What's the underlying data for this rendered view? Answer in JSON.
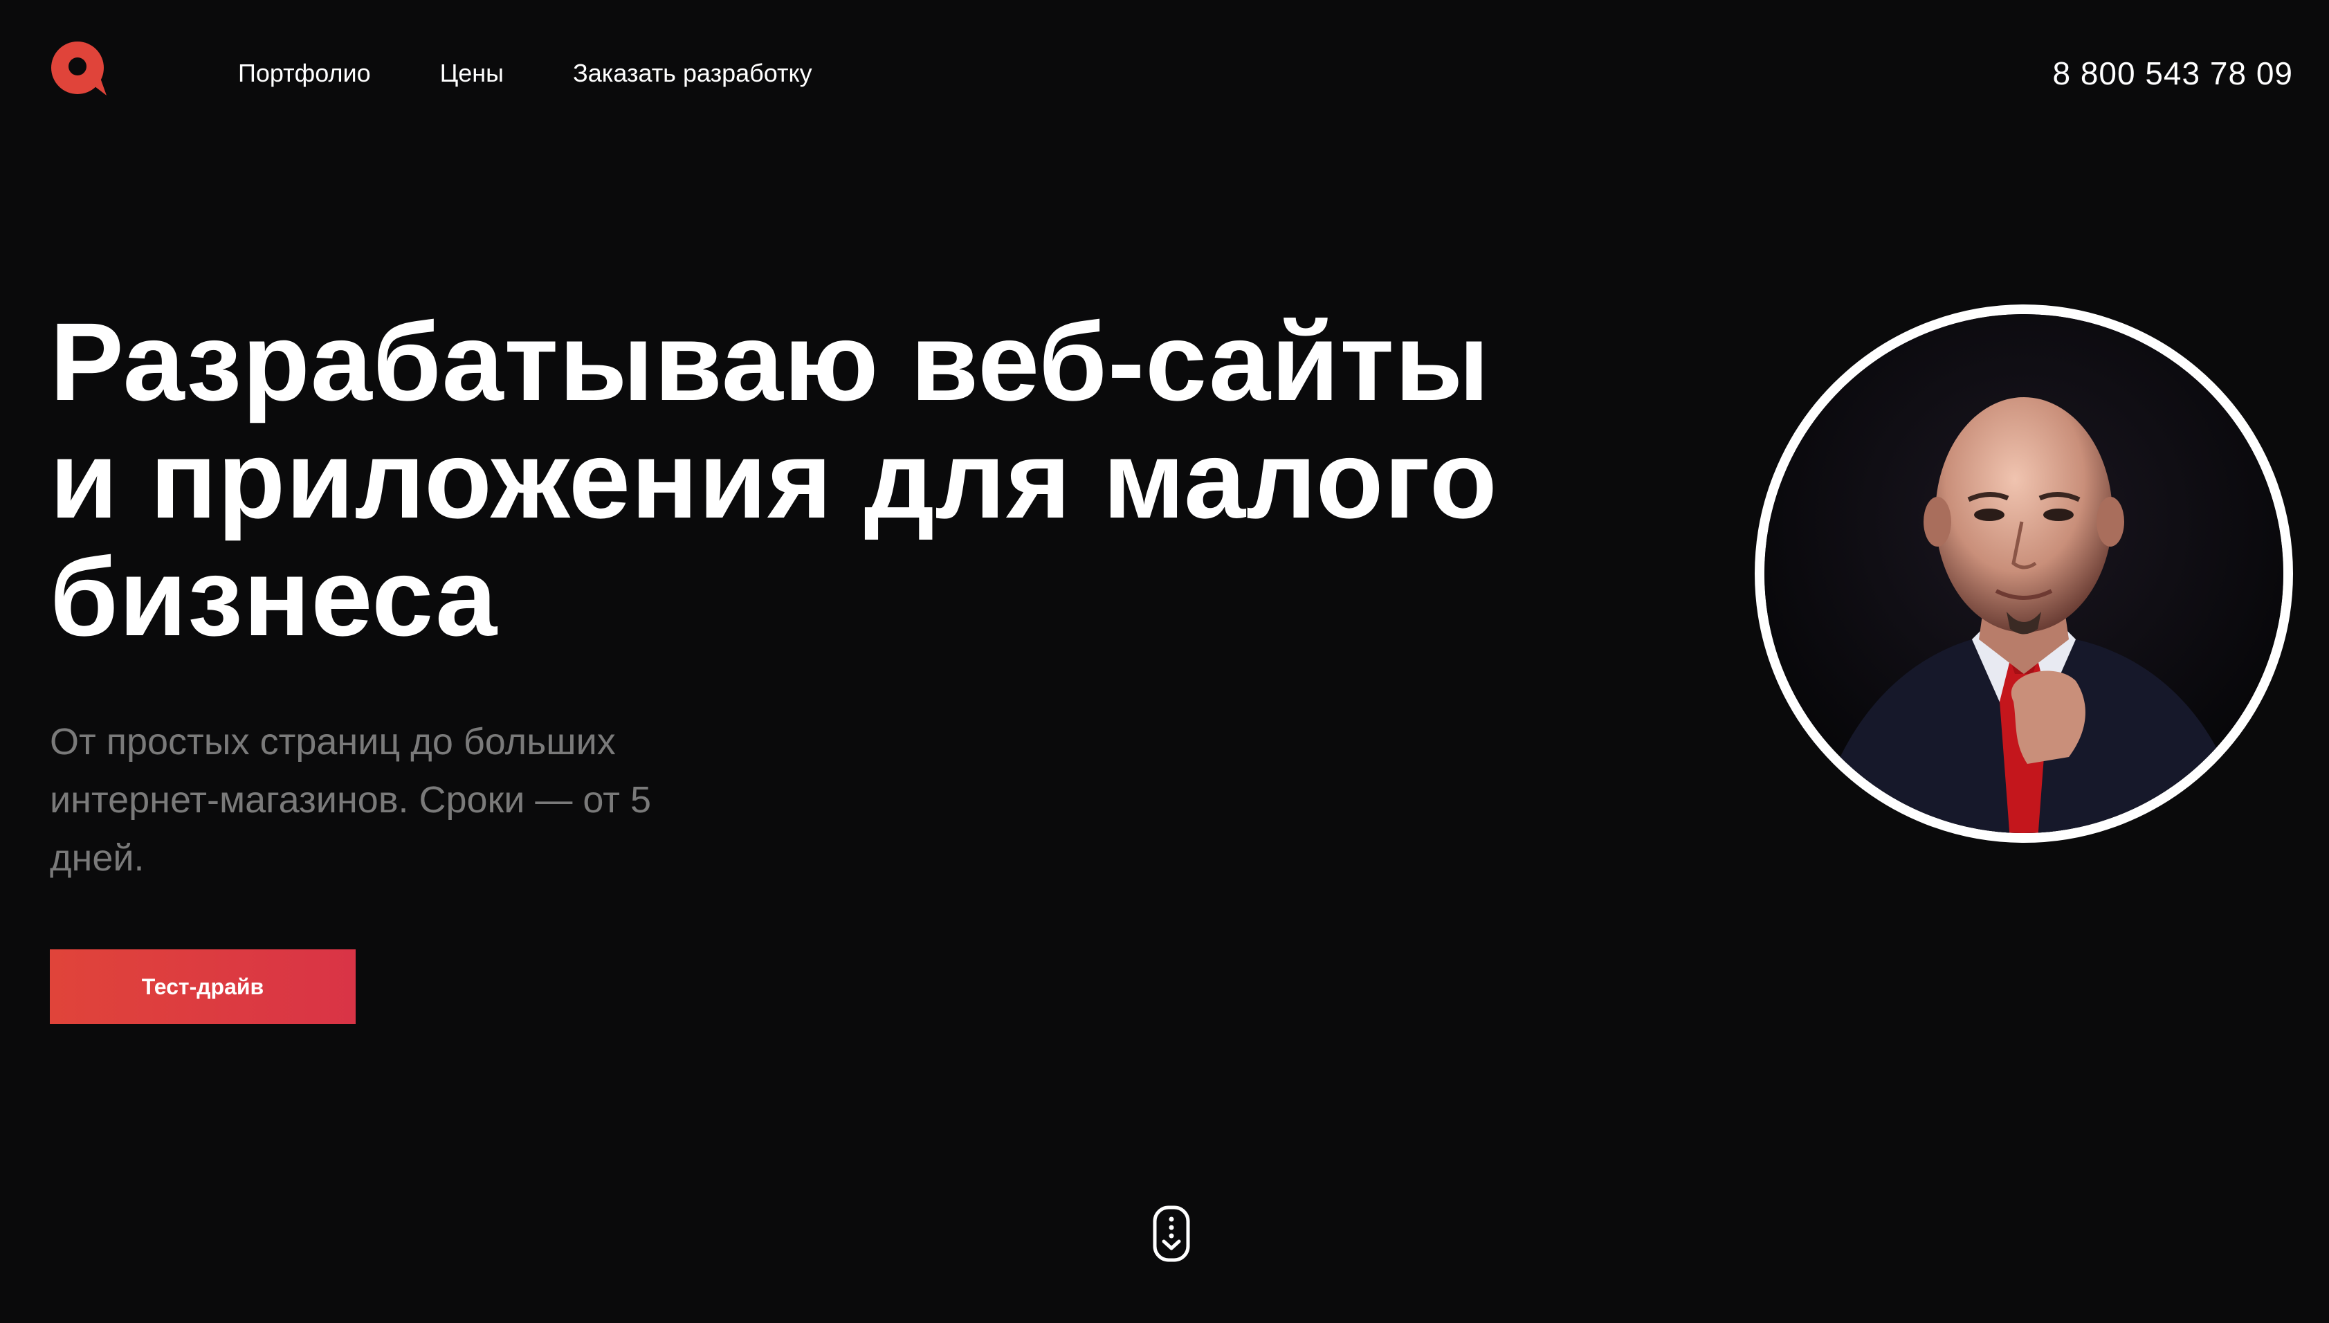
{
  "header": {
    "logo_icon": "q-speech-bubble-logo",
    "nav": [
      {
        "label": "Портфолио"
      },
      {
        "label": "Цены"
      },
      {
        "label": "Заказать разработку"
      }
    ],
    "phone": "8 800 543 78 09"
  },
  "hero": {
    "title_lines": [
      "Разрабатываю веб-сайты",
      "и приложения для малого",
      "бизнеса"
    ],
    "subtitle": "От простых страниц до больших интернет-магазинов. Сроки — от 5 дней.",
    "cta_label": "Тест-драйв",
    "avatar_icon": "portrait-photo",
    "scroll_icon": "scroll-down-mouse-icon"
  },
  "colors": {
    "background": "#0a0a0b",
    "accent": "#e0443a",
    "text": "#ffffff",
    "muted_text": "#7a7a7a"
  }
}
